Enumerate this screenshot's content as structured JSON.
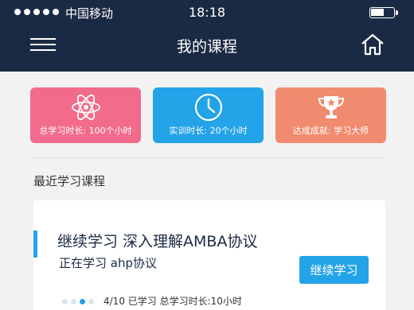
{
  "status_bar": {
    "carrier": "中国移动",
    "time": "18:18"
  },
  "nav": {
    "title": "我的课程",
    "menu_icon": "menu-icon",
    "home_icon": "home-icon"
  },
  "stats": [
    {
      "label": "总学习时长: 100个小时",
      "icon": "atom-icon",
      "color": "#f26b8a"
    },
    {
      "label": "实训时长: 20个小时",
      "icon": "clock-icon",
      "color": "#23a3e8"
    },
    {
      "label": "达成成就: 学习大师",
      "icon": "trophy-icon",
      "color": "#f08b6f"
    }
  ],
  "recent": {
    "section_title": "最近学习课程",
    "course": {
      "title": "继续学习   深入理解AMBA协议",
      "subtitle": "正在学习   ahp协议",
      "button_label": "继续学习",
      "progress_text": "4/10 已学习   总学习时长:10小时"
    }
  },
  "colors": {
    "header_bg": "#1b2a44",
    "accent": "#23a3e8"
  }
}
